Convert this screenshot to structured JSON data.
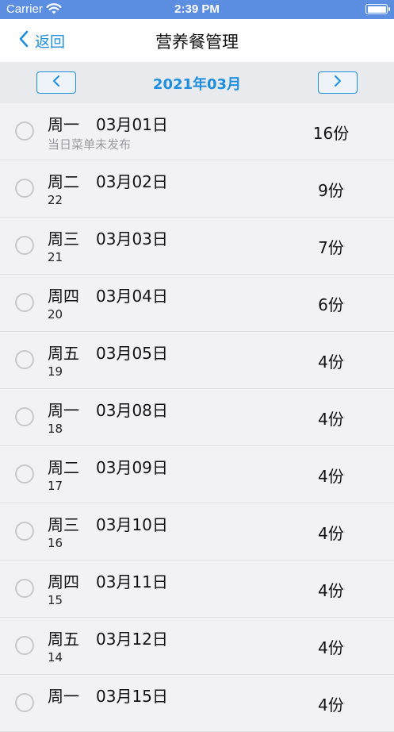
{
  "status_bar": {
    "carrier": "Carrier",
    "time": "2:39 PM"
  },
  "nav": {
    "back_label": "返回",
    "title": "营养餐管理"
  },
  "month_selector": {
    "label": "2021年03月"
  },
  "colors": {
    "accent": "#1e8fe0",
    "status_bar": "#5b8ee0"
  },
  "days": [
    {
      "weekday": "周一",
      "date": "03月01日",
      "sub": "当日菜单未发布",
      "qty": "16份"
    },
    {
      "weekday": "周二",
      "date": "03月02日",
      "sub": "22",
      "qty": "9份"
    },
    {
      "weekday": "周三",
      "date": "03月03日",
      "sub": "21",
      "qty": "7份"
    },
    {
      "weekday": "周四",
      "date": "03月04日",
      "sub": "20",
      "qty": "6份"
    },
    {
      "weekday": "周五",
      "date": "03月05日",
      "sub": "19",
      "qty": "4份"
    },
    {
      "weekday": "周一",
      "date": "03月08日",
      "sub": "18",
      "qty": "4份"
    },
    {
      "weekday": "周二",
      "date": "03月09日",
      "sub": "17",
      "qty": "4份"
    },
    {
      "weekday": "周三",
      "date": "03月10日",
      "sub": "16",
      "qty": "4份"
    },
    {
      "weekday": "周四",
      "date": "03月11日",
      "sub": "15",
      "qty": "4份"
    },
    {
      "weekday": "周五",
      "date": "03月12日",
      "sub": "14",
      "qty": "4份"
    },
    {
      "weekday": "周一",
      "date": "03月15日",
      "sub": "",
      "qty": "4份"
    }
  ]
}
